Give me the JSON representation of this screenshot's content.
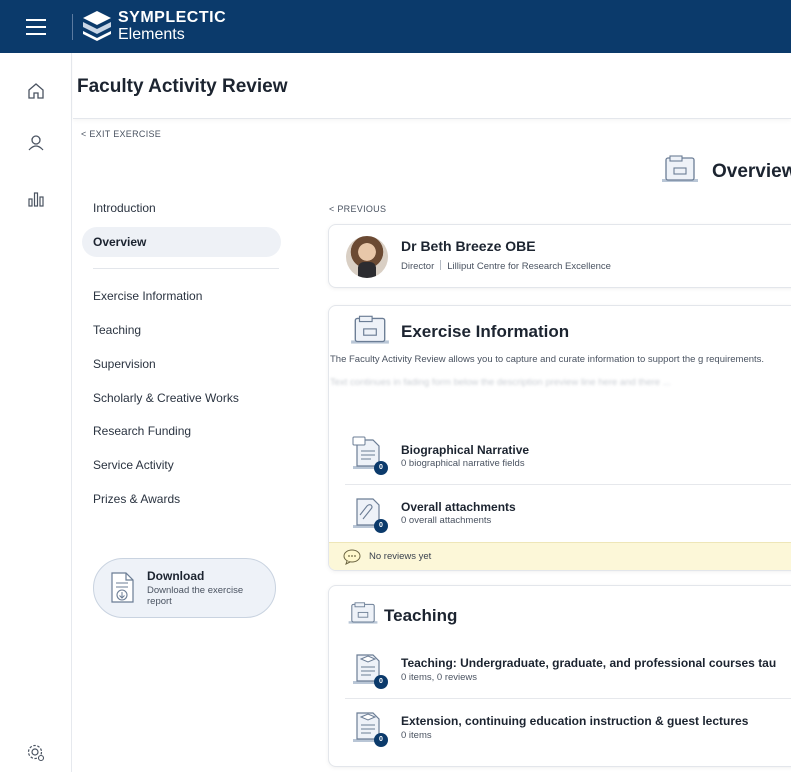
{
  "brand": {
    "line1": "SYMPLECTIC",
    "line2": "Elements"
  },
  "header": {
    "title": "Faculty Activity Review"
  },
  "exit_label": "< EXIT EXERCISE",
  "overview_heading": "Overview",
  "sidenav": {
    "items": [
      {
        "label": "Introduction",
        "active": false
      },
      {
        "label": "Overview",
        "active": true
      },
      {
        "label": "Exercise Information",
        "active": false
      },
      {
        "label": "Teaching",
        "active": false
      },
      {
        "label": "Supervision",
        "active": false
      },
      {
        "label": "Scholarly & Creative Works",
        "active": false
      },
      {
        "label": "Research Funding",
        "active": false
      },
      {
        "label": "Service Activity",
        "active": false
      },
      {
        "label": "Prizes & Awards",
        "active": false
      }
    ]
  },
  "download": {
    "title": "Download",
    "subtitle": "Download the exercise report"
  },
  "previous_label": "< PREVIOUS",
  "person": {
    "name": "Dr Beth Breeze OBE",
    "role": "Director",
    "org": "Lilliput Centre for Research Excellence"
  },
  "exercise_info": {
    "title": "Exercise Information",
    "description": "The Faculty Activity Review  allows you to capture and curate information to support the g requirements.",
    "faded_text": "Text continues in fading form below the description preview line here and there ...",
    "rows": [
      {
        "title": "Biographical Narrative",
        "subtitle": "0 biographical narrative fields",
        "count": "0"
      },
      {
        "title": "Overall attachments",
        "subtitle": "0 overall attachments",
        "count": "0"
      }
    ],
    "reviews_text": "No reviews yet"
  },
  "teaching": {
    "title": "Teaching",
    "rows": [
      {
        "title": "Teaching: Undergraduate, graduate, and professional courses tau",
        "subtitle": "0 items, 0 reviews",
        "count": "0"
      },
      {
        "title": "Extension, continuing education instruction & guest lectures",
        "subtitle": "0 items",
        "count": "0"
      }
    ]
  },
  "colors": {
    "topbar": "#0b3a6b",
    "active_nav": "#eef1f6",
    "review_bar": "#fcf7d8",
    "badge": "#0b3a6b"
  },
  "icons": [
    "menu-icon",
    "home-icon",
    "user-icon",
    "chart-icon",
    "settings-icon",
    "folder-icon",
    "document-icon",
    "attachment-icon",
    "chat-icon",
    "download-icon"
  ]
}
